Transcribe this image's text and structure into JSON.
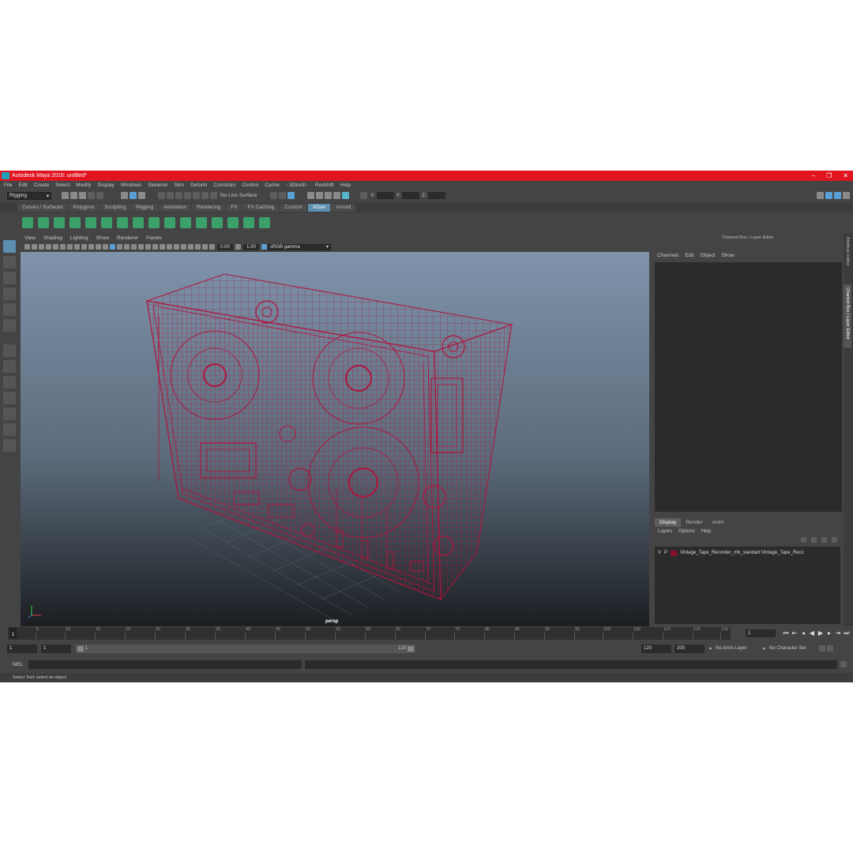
{
  "window": {
    "title": "Autodesk Maya 2016: untitled*",
    "controls": [
      "–",
      "❐",
      "✕"
    ]
  },
  "menubar": [
    "File",
    "Edit",
    "Create",
    "Select",
    "Modify",
    "Display",
    "Windows",
    "Skeleton",
    "Skin",
    "Deform",
    "Constrain",
    "Control",
    "Cache",
    "- 3DtoAll -",
    "Redshift",
    "Help"
  ],
  "toolbar": {
    "mode_menu": "Rigging",
    "live_surface": "No Live Surface"
  },
  "shelf_tabs": [
    {
      "label": "Curves / Surfaces",
      "active": false
    },
    {
      "label": "Polygons",
      "active": false
    },
    {
      "label": "Sculpting",
      "active": false
    },
    {
      "label": "Rigging",
      "active": false
    },
    {
      "label": "Animation",
      "active": false
    },
    {
      "label": "Rendering",
      "active": false
    },
    {
      "label": "FX",
      "active": false
    },
    {
      "label": "FX Caching",
      "active": false
    },
    {
      "label": "Custom",
      "active": false
    },
    {
      "label": "XGen",
      "active": true
    },
    {
      "label": "Arnold",
      "active": false
    }
  ],
  "viewport": {
    "menu": [
      "View",
      "Shading",
      "Lighting",
      "Show",
      "Renderer",
      "Panels"
    ],
    "exposure": "0.00",
    "gamma": "1.00",
    "color_space": "sRGB gamma",
    "camera_label": "persp",
    "wire_color": "#b0143c"
  },
  "channel_box": {
    "title": "Channel Box / Layer Editor",
    "menu": [
      "Channels",
      "Edit",
      "Object",
      "Show"
    ]
  },
  "layer_editor": {
    "tabs": [
      {
        "label": "Display",
        "active": true
      },
      {
        "label": "Render",
        "active": false
      },
      {
        "label": "Anim",
        "active": false
      }
    ],
    "menu": [
      "Layers",
      "Options",
      "Help"
    ],
    "layers": [
      {
        "v": "V",
        "p": "P",
        "color": "#8b0e2a",
        "name": "Vintage_Tape_Recorder_mb_standart:Vintage_Tape_Recc"
      }
    ]
  },
  "side_tabs": [
    "Attribute Editor",
    "Channel Box / Layer Editor"
  ],
  "timeline": {
    "ticks": [
      "5",
      "10",
      "15",
      "20",
      "25",
      "30",
      "35",
      "40",
      "45",
      "50",
      "55",
      "60",
      "65",
      "70",
      "75",
      "80",
      "85",
      "90",
      "95",
      "100",
      "105",
      "110",
      "115",
      "120"
    ],
    "current_frame": "1",
    "current_frame_field": "1"
  },
  "range": {
    "start": "1",
    "playback_start": "1",
    "slider_start": "1",
    "slider_end": "120",
    "playback_end": "120",
    "end": "200",
    "anim_layer": "No Anim Layer",
    "character_set": "No Character Set"
  },
  "command_line": {
    "language": "MEL"
  },
  "help_line": "Select Tool: select an object"
}
